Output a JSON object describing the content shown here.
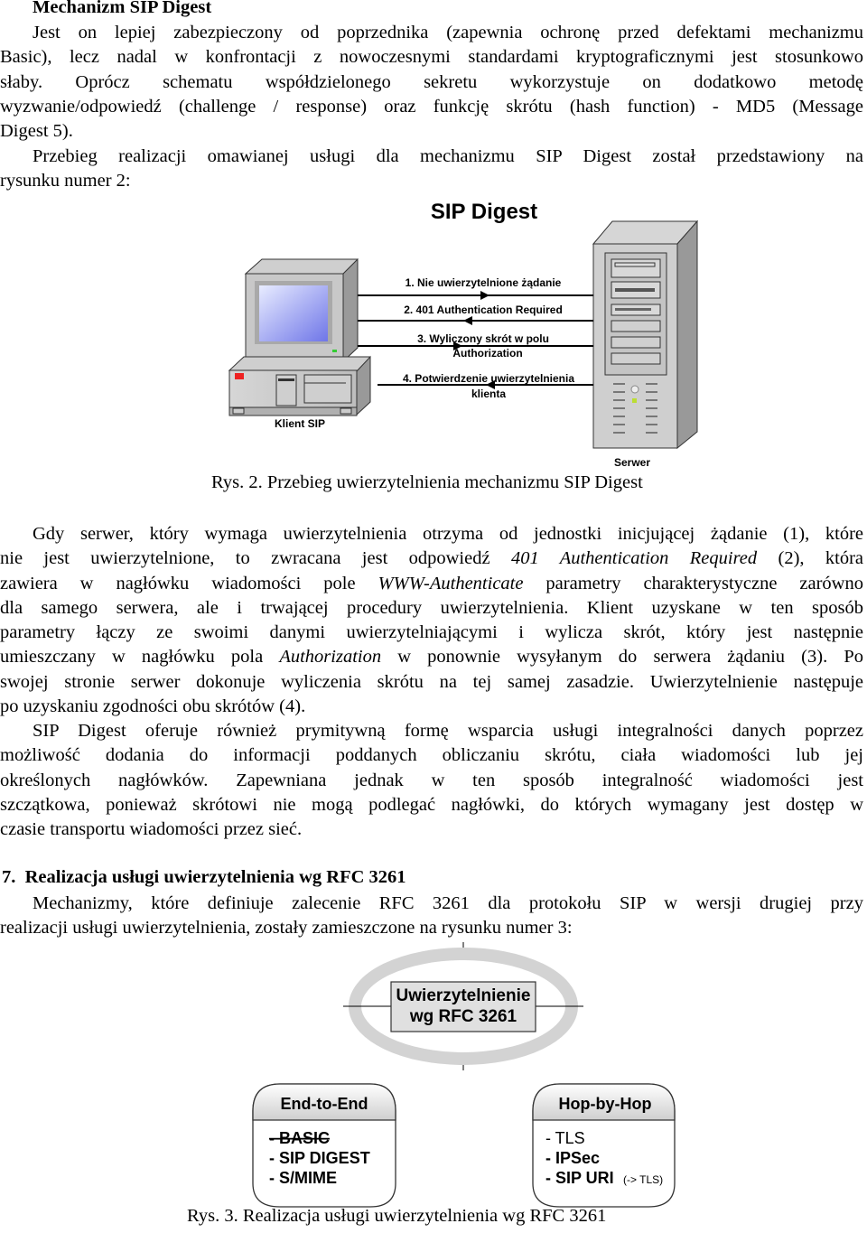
{
  "section_heading": "Mechanizm SIP Digest",
  "para1": [
    "Jest on lepiej zabezpieczony od poprzednika (zapewnia ochronę przed defektami mechanizmu",
    "Basic), lecz nadal w konfrontacji z nowoczesnymi standardami kryptograficznymi jest stosunkowo",
    "słaby. Oprócz schematu współdzielonego sekretu wykorzystuje on dodatkowo metodę",
    "wyzwanie/odpowiedź (challenge / response) oraz funkcję skrótu (hash function) - MD5 (Message",
    "Digest 5)."
  ],
  "para2": [
    "Przebieg realizacji omawianej usługi dla mechanizmu SIP Digest został przedstawiony na",
    "rysunku numer 2:"
  ],
  "figure2": {
    "title": "SIP Digest",
    "client_label": "Klient SIP",
    "server_label": "Serwer",
    "messages": [
      {
        "line1": "1. Nie uwierzytelnione żądanie",
        "line2": "",
        "direction": "client-to-server"
      },
      {
        "line1": "2. 401 Authentication Required",
        "line2": "",
        "direction": "server-to-client"
      },
      {
        "line1": "3. Wyliczony skrót w polu",
        "line2": "Authorization",
        "direction": "client-to-server"
      },
      {
        "line1": "4. Potwierdzenie uwierzytelnienia",
        "line2": "klienta",
        "direction": "server-to-client"
      }
    ],
    "caption": "Rys. 2. Przebieg uwierzytelnienia mechanizmu SIP Digest"
  },
  "para3": {
    "l1": "Gdy serwer, który wymaga uwierzytelnienia otrzyma od jednostki inicjującej żądanie (1), które",
    "l2a": "nie jest uwierzytelnione, to zwracana jest odpowiedź ",
    "l2i": "401 Authentication Required",
    "l2b": " (2), która",
    "l3a": "zawiera w nagłówku wiadomości pole ",
    "l3i": "WWW-Authenticate",
    "l3b": " parametry charakterystyczne zarówno",
    "l4": "dla samego serwera, ale i trwającej procedury uwierzytelnienia. Klient uzyskane w ten sposób",
    "l5": "parametry łączy ze swoimi danymi uwierzytelniającymi i wylicza skrót, który jest następnie",
    "l6a": "umieszczany w nagłówku pola ",
    "l6i": "Authorization",
    "l6b": " w ponownie wysyłanym do serwera żądaniu (3). Po",
    "l7": "swojej stronie serwer dokonuje wyliczenia skrótu na tej samej zasadzie. Uwierzytelnienie następuje",
    "l8": "po uzyskaniu zgodności obu skrótów (4)."
  },
  "para4": [
    "SIP Digest oferuje również prymitywną formę wsparcia usługi integralności danych poprzez",
    "możliwość dodania do informacji poddanych obliczaniu skrótu, ciała wiadomości lub jej",
    "określonych nagłówków. Zapewniana jednak w ten sposób integralność wiadomości jest",
    "szczątkowa, ponieważ skrótowi nie mogą podlegać nagłówki, do których wymagany jest dostęp w",
    "czasie transportu wiadomości przez sieć."
  ],
  "section7_heading": "7.  Realizacja usługi uwierzytelnienia wg RFC 3261",
  "para5": [
    "Mechanizmy, które definiuje zalecenie RFC 3261 dla protokołu SIP w wersji drugiej przy",
    "realizacji usługi uwierzytelnienia, zostały zamieszczone na rysunku numer 3:"
  ],
  "figure3": {
    "center_line1": "Uwierzytelnienie",
    "center_line2": "wg RFC 3261",
    "end_to_end": {
      "title": "End-to-End",
      "items": [
        {
          "text": "- BASIC",
          "struck": true
        },
        {
          "text": "- SIP DIGEST",
          "struck": false
        },
        {
          "text": "- S/MIME",
          "struck": false
        }
      ]
    },
    "hop_by_hop": {
      "title": "Hop-by-Hop",
      "items": [
        {
          "text": "- TLS",
          "bold": false
        },
        {
          "text": "- IPSec",
          "bold": true
        },
        {
          "text": "- SIP URI",
          "bold": true,
          "note": "(-> TLS)"
        }
      ]
    },
    "caption": "Rys. 3. Realizacja usługi uwierzytelnienia wg RFC 3261"
  }
}
